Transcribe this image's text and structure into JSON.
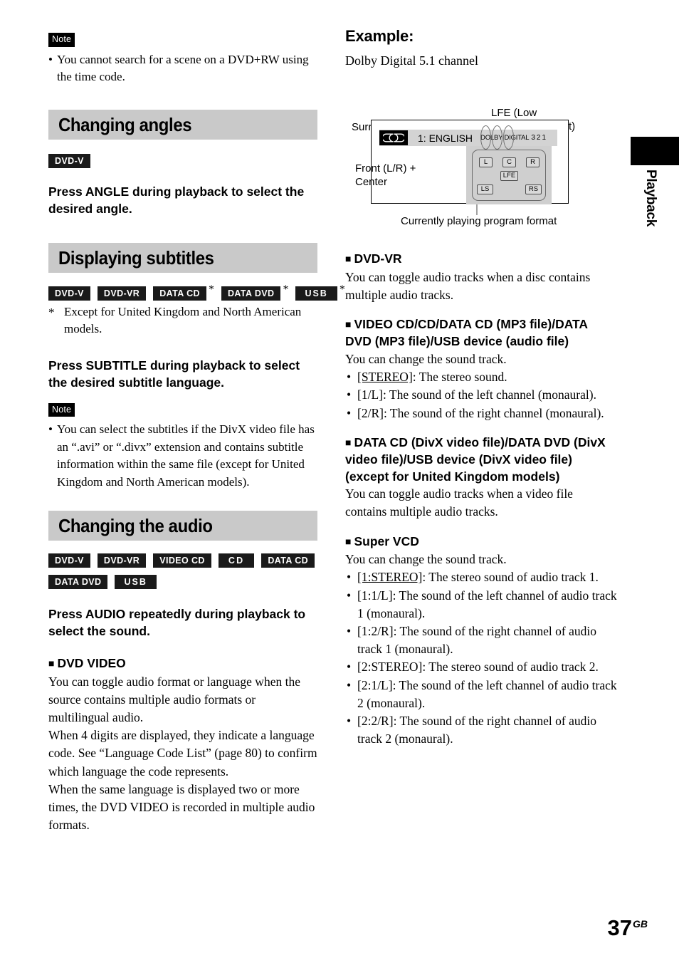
{
  "page": {
    "number": "37",
    "region_suffix": "GB",
    "side_tab": "Playback"
  },
  "left_column": {
    "note_top": {
      "label": "Note",
      "items": [
        "You cannot search for a scene on a DVD+RW using the time code."
      ]
    },
    "section_angles": {
      "title": "Changing angles",
      "badges": [
        {
          "text": "DVD-V",
          "star": false
        }
      ],
      "instruction": "Press ANGLE during playback to select the desired angle."
    },
    "section_subtitles": {
      "title": "Displaying subtitles",
      "badges": [
        {
          "text": "DVD-V",
          "star": false
        },
        {
          "text": "DVD-VR",
          "star": false
        },
        {
          "text": "DATA CD",
          "star": true
        },
        {
          "text": "DATA DVD",
          "star": true
        },
        {
          "text": "USB",
          "star": true
        }
      ],
      "footnote_mark": "*",
      "footnote": "Except for United Kingdom and North American models.",
      "instruction": "Press SUBTITLE during playback to select the desired subtitle language.",
      "note": {
        "label": "Note",
        "items": [
          "You can select the subtitles if the DivX video file has an “.avi” or “.divx” extension and contains subtitle information within the same file (except for United Kingdom and North American models)."
        ]
      }
    },
    "section_audio": {
      "title": "Changing the audio",
      "badges_row1": [
        {
          "text": "DVD-V"
        },
        {
          "text": "DVD-VR"
        },
        {
          "text": "VIDEO CD"
        },
        {
          "text": "CD"
        },
        {
          "text": "DATA CD"
        }
      ],
      "badges_row2": [
        {
          "text": "DATA DVD"
        },
        {
          "text": "USB"
        }
      ],
      "instruction": "Press AUDIO repeatedly during playback to select the sound.",
      "dvd_video": {
        "heading": "DVD VIDEO",
        "paragraphs": [
          "You can toggle audio format or language when the source contains multiple audio formats or multilingual audio.",
          "When 4 digits are displayed, they indicate a language code. See “Language Code List” (page 80) to confirm which language the code represents.",
          "When the same language is displayed two or more times, the DVD VIDEO is recorded in multiple audio formats."
        ]
      }
    }
  },
  "right_column": {
    "example": {
      "title": "Example:",
      "subtitle": "Dolby Digital 5.1 channel"
    },
    "diagram": {
      "label_surround": "Surround (L/R)",
      "label_lfe": "LFE (Low\nFrequency Effect)",
      "label_front": "Front (L/R) +\nCenter",
      "caption": "Currently playing program format",
      "display_bar": {
        "logo_icon": "dolby-double-d-icon",
        "track": "1: ENGLISH",
        "format": "DOLBY DIGITAL",
        "channel_numbers": [
          "3",
          "2",
          "1"
        ]
      },
      "speakers": [
        "L",
        "C",
        "R",
        "LFE",
        "LS",
        "RS"
      ]
    },
    "dvd_vr": {
      "heading": "DVD-VR",
      "paragraph": "You can toggle audio tracks when a disc contains multiple audio tracks."
    },
    "video_cd": {
      "heading": "VIDEO CD/CD/DATA CD (MP3 file)/DATA DVD (MP3 file)/USB device (audio file)",
      "paragraph": "You can change the sound track.",
      "bullets": [
        {
          "key": "[STEREO]",
          "underline": true,
          "text": ": The stereo sound."
        },
        {
          "key": "[1/L]",
          "underline": false,
          "text": ": The sound of the left channel (monaural)."
        },
        {
          "key": "[2/R]",
          "underline": false,
          "text": ": The sound of the right channel (monaural)."
        }
      ]
    },
    "data_cd_divx": {
      "heading_main": "DATA CD (DivX video file)/DATA DVD (DivX video file)/USB device (DivX video file) ",
      "heading_paren": "(except for United Kingdom models)",
      "paragraph": "You can toggle audio tracks when a video file contains multiple audio tracks."
    },
    "super_vcd": {
      "heading": "Super VCD",
      "paragraph": "You can change the sound track.",
      "bullets": [
        {
          "key": "[1:STEREO]",
          "underline": true,
          "text": ": The stereo sound of audio track 1."
        },
        {
          "key": "[1:1/L]",
          "underline": false,
          "text": ": The sound of the left channel of audio track 1 (monaural)."
        },
        {
          "key": "[1:2/R]",
          "underline": false,
          "text": ": The sound of the right channel of audio track 1 (monaural)."
        },
        {
          "key": "[2:STEREO]",
          "underline": false,
          "text": ": The stereo sound of audio track 2."
        },
        {
          "key": "[2:1/L]",
          "underline": false,
          "text": ": The sound of the left channel of audio track 2 (monaural)."
        },
        {
          "key": "[2:2/R]",
          "underline": false,
          "text": ": The sound of the right channel of audio track 2 (monaural)."
        }
      ]
    }
  }
}
